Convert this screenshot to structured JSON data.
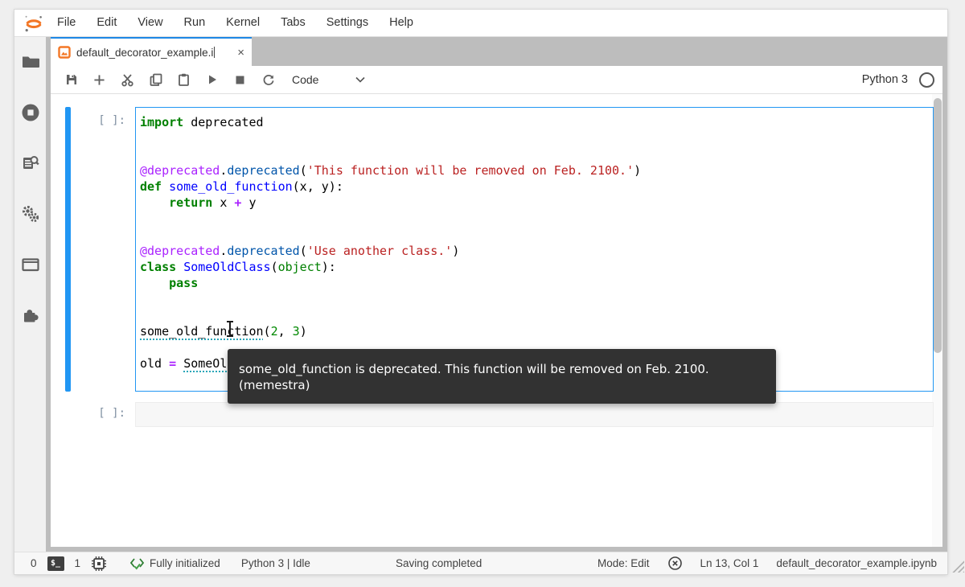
{
  "menu": {
    "items": [
      "File",
      "Edit",
      "View",
      "Run",
      "Kernel",
      "Tabs",
      "Settings",
      "Help"
    ]
  },
  "tab": {
    "title": "default_decorator_example.i",
    "close": "×"
  },
  "toolbar": {
    "cell_type": "Code",
    "kernel_name": "Python 3"
  },
  "sidebar": {
    "icons": [
      "file-browser",
      "running-sessions",
      "command-palette",
      "property-inspector",
      "open-tabs",
      "extension-manager"
    ]
  },
  "notebook": {
    "prompt": "[ ]:",
    "code_lines": [
      [
        {
          "c": "kw",
          "t": "import"
        },
        {
          "c": "pl",
          "t": " deprecated"
        }
      ],
      [],
      [],
      [
        {
          "c": "mt",
          "t": "@deprecated"
        },
        {
          "c": "pl",
          "t": "."
        },
        {
          "c": "pr",
          "t": "deprecated"
        },
        {
          "c": "pl",
          "t": "("
        },
        {
          "c": "st",
          "t": "'This function will be removed on Feb. 2100.'"
        },
        {
          "c": "pl",
          "t": ")"
        }
      ],
      [
        {
          "c": "kw",
          "t": "def"
        },
        {
          "c": "pl",
          "t": " "
        },
        {
          "c": "df",
          "t": "some_old_function"
        },
        {
          "c": "pl",
          "t": "(x, y):"
        }
      ],
      [
        {
          "c": "pl",
          "t": "    "
        },
        {
          "c": "kw",
          "t": "return"
        },
        {
          "c": "pl",
          "t": " x "
        },
        {
          "c": "op",
          "t": "+"
        },
        {
          "c": "pl",
          "t": " y"
        }
      ],
      [],
      [],
      [
        {
          "c": "mt",
          "t": "@deprecated"
        },
        {
          "c": "pl",
          "t": "."
        },
        {
          "c": "pr",
          "t": "deprecated"
        },
        {
          "c": "pl",
          "t": "("
        },
        {
          "c": "st",
          "t": "'Use another class.'"
        },
        {
          "c": "pl",
          "t": ")"
        }
      ],
      [
        {
          "c": "kw",
          "t": "class"
        },
        {
          "c": "pl",
          "t": " "
        },
        {
          "c": "df",
          "t": "SomeOldClass"
        },
        {
          "c": "pl",
          "t": "("
        },
        {
          "c": "bi",
          "t": "object"
        },
        {
          "c": "pl",
          "t": "):"
        }
      ],
      [
        {
          "c": "pl",
          "t": "    "
        },
        {
          "c": "kw",
          "t": "pass"
        }
      ],
      [],
      [],
      [
        {
          "c": "ul",
          "t": "some_old_function"
        },
        {
          "c": "pl",
          "t": "("
        },
        {
          "c": "nm",
          "t": "2"
        },
        {
          "c": "pl",
          "t": ", "
        },
        {
          "c": "nm",
          "t": "3"
        },
        {
          "c": "pl",
          "t": ")"
        }
      ],
      [],
      [
        {
          "c": "pl",
          "t": "old "
        },
        {
          "c": "op",
          "t": "="
        },
        {
          "c": "pl",
          "t": " "
        },
        {
          "c": "ul",
          "t": "SomeOldClass"
        },
        {
          "c": "pl",
          "t": "()"
        }
      ]
    ]
  },
  "tooltip": {
    "lines": [
      "some_old_function is deprecated. This function will be removed on Feb. 2100.",
      "(memestra)"
    ]
  },
  "status_bar": {
    "terminals_count": "0",
    "terminal_badge": "$_",
    "kernels_count": "1",
    "lsp_status": "Fully initialized",
    "kernel_status": "Python 3 | Idle",
    "saving_status": "Saving completed",
    "mode": "Mode: Edit",
    "cursor_position": "Ln 13, Col 1",
    "filename": "default_decorator_example.ipynb"
  },
  "colors": {
    "accent_blue": "#2196f3",
    "tab_accent": "#1e88e5",
    "brand_orange": "#f37726",
    "dock_background": "#bdbdbd",
    "tooltip_background": "#323232",
    "icon_gray": "#616161",
    "lsp_green": "#43a047",
    "string_red": "#ba2121",
    "keyword_green": "#008000",
    "meta_purple": "#aa22ff"
  }
}
